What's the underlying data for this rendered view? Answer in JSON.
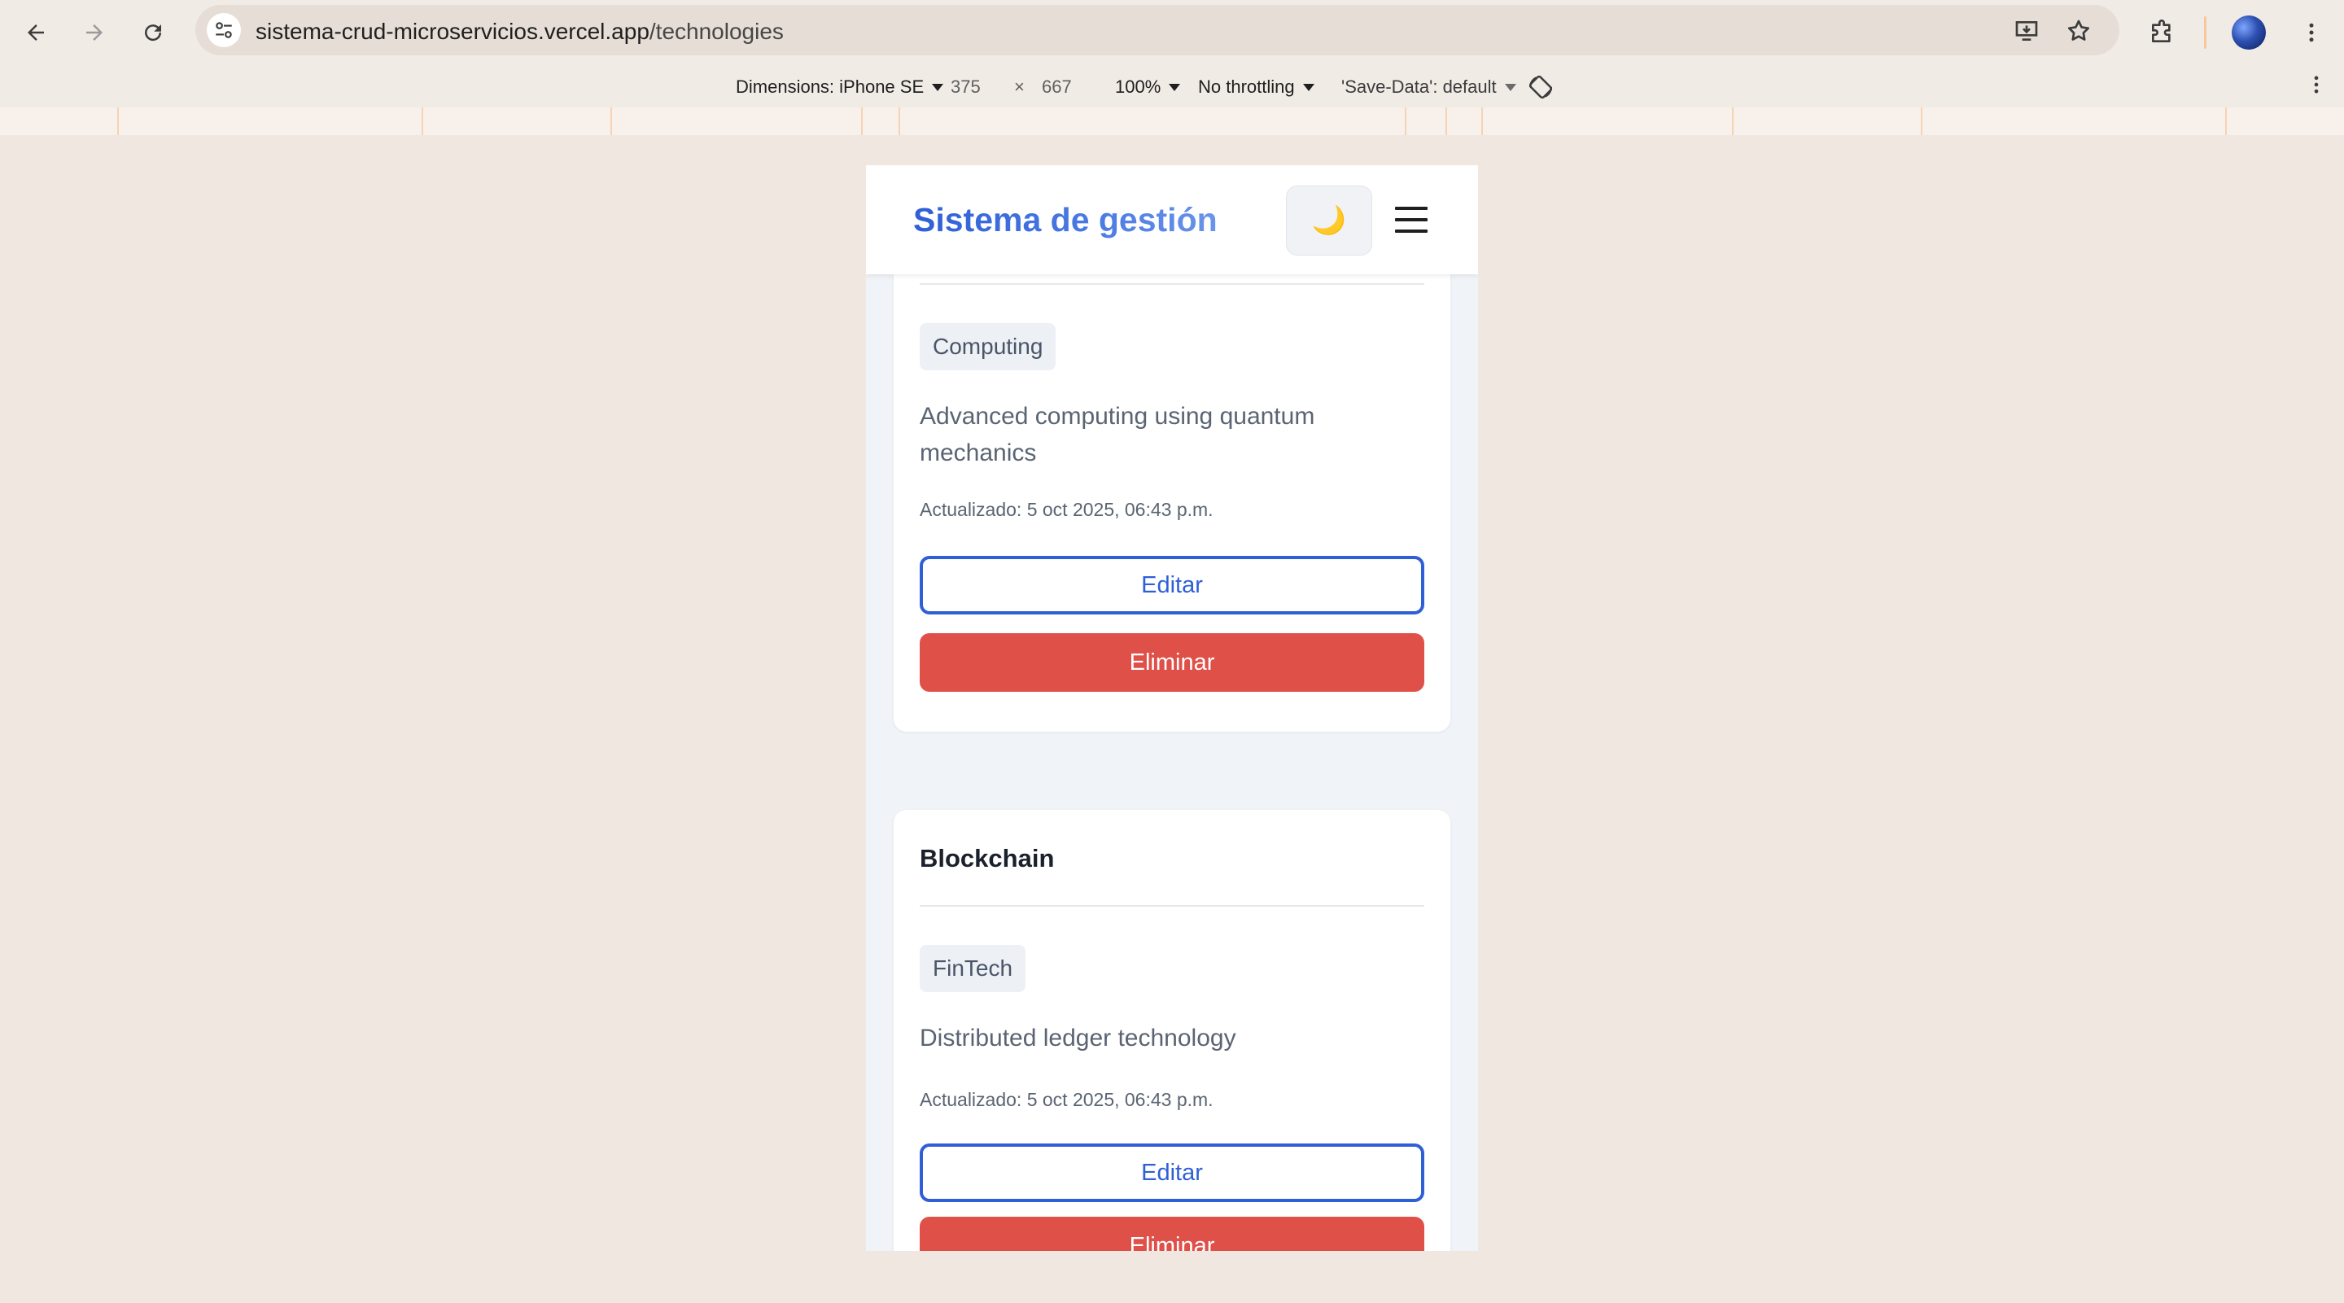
{
  "browser": {
    "url_host": "sistema-crud-microservicios.vercel.app",
    "url_path": "/technologies",
    "nav_icons": [
      "back-arrow-icon",
      "forward-arrow-icon",
      "reload-icon"
    ],
    "toolbar_icons": [
      "install-app-icon",
      "bookmark-star-icon",
      "extensions-puzzle-icon",
      "profile-avatar",
      "more-vertical-icon"
    ]
  },
  "devtools": {
    "dimensions_label": "Dimensions: iPhone SE",
    "width": "375",
    "times": "×",
    "height": "667",
    "zoom": "100%",
    "throttling": "No throttling",
    "save_data": "'Save-Data': default",
    "rotate_icon": "rotate-device-icon",
    "more_icon": "more-vertical-icon"
  },
  "app": {
    "brand": "Sistema de gestión",
    "theme_toggle_icon": "🌙",
    "menu_icon": "hamburger-menu-icon",
    "brand_color": "#2f5fd6",
    "danger_color": "#df5048"
  },
  "cards": [
    {
      "category": "Computing",
      "description": "Advanced computing using quantum mechanics",
      "updated": "Actualizado: 5 oct 2025, 06:43 p.m.",
      "edit_label": "Editar",
      "delete_label": "Eliminar"
    },
    {
      "title": "Blockchain",
      "category": "FinTech",
      "description": "Distributed ledger technology",
      "updated": "Actualizado: 5 oct 2025, 06:43 p.m.",
      "edit_label": "Editar",
      "delete_label": "Eliminar"
    }
  ]
}
